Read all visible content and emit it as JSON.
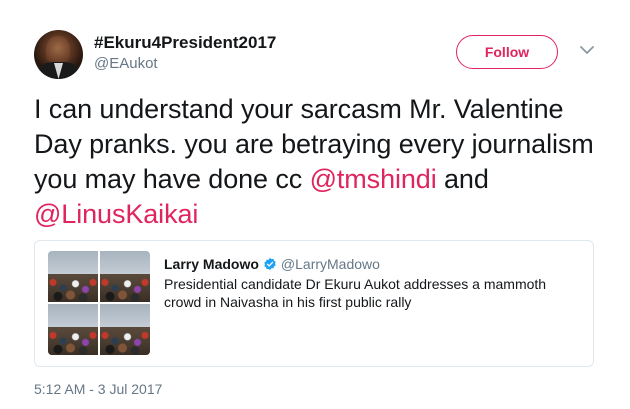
{
  "tweet": {
    "author": {
      "display_name": "#Ekuru4President2017",
      "handle": "@EAukot",
      "avatar_icon": "profile-avatar"
    },
    "follow_label": "Follow",
    "menu_icon": "chevron-down-icon",
    "text_segments": [
      {
        "text": "I can understand your sarcasm Mr. Valentine Day pranks. you are betraying every journalism you may have done cc ",
        "type": "plain"
      },
      {
        "text": "@tmshindi",
        "type": "mention"
      },
      {
        "text": " and ",
        "type": "plain"
      },
      {
        "text": "@LinusKaikai",
        "type": "mention"
      }
    ],
    "timestamp": "5:12 AM - 3 Jul 2017"
  },
  "quoted_tweet": {
    "author_name": "Larry Madowo",
    "author_handle": "@LarryMadowo",
    "verified_icon": "verified-badge-icon",
    "text": "Presidential candidate Dr Ekuru Aukot addresses a mammoth crowd in Naivasha in his first public rally",
    "media_count": 4
  },
  "colors": {
    "accent": "#e0245e",
    "text": "#14171a",
    "secondary": "#657786",
    "border": "#e1e8ed",
    "verified": "#1da1f2"
  }
}
